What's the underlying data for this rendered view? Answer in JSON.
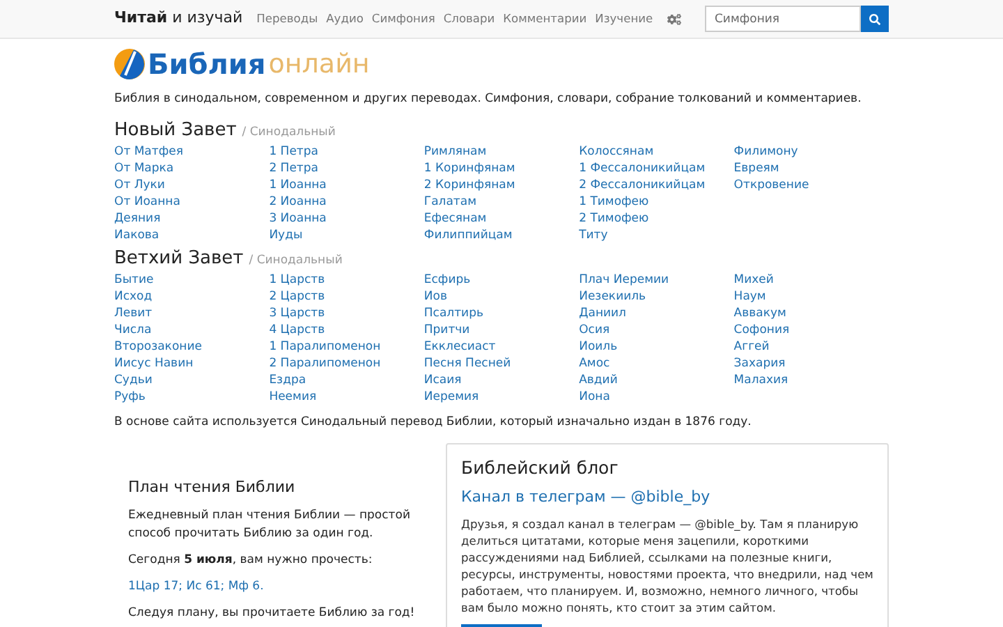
{
  "navbar": {
    "brand": "**Читай** и изучай",
    "links": [
      "Переводы",
      "Аудио",
      "Симфония",
      "Словари",
      "Комментарии",
      "Изучение"
    ],
    "search": {
      "placeholder": "Симфония"
    }
  },
  "logo": {
    "title": "Библия",
    "subtitle": "онлайн"
  },
  "tagline": "Библия в синодальном, современном и других переводах. Симфония, словари, собрание толкований и комментариев.",
  "sections": [
    {
      "title": "Новый Завет",
      "translation": "/ Синодальный",
      "columns": [
        [
          "От Матфея",
          "От Марка",
          "От Луки",
          "От Иоанна",
          "Деяния",
          "Иакова"
        ],
        [
          "1 Петра",
          "2 Петра",
          "1 Иоанна",
          "2 Иоанна",
          "3 Иоанна",
          "Иуды"
        ],
        [
          "Римлянам",
          "1 Коринфянам",
          "2 Коринфянам",
          "Галатам",
          "Ефесянам",
          "Филиппийцам"
        ],
        [
          "Колоссянам",
          "1 Фессалоникийцам",
          "2 Фессалоникийцам",
          "1 Тимофею",
          "2 Тимофею",
          "Титу"
        ],
        [
          "Филимону",
          "Евреям",
          "Откровение"
        ]
      ]
    },
    {
      "title": "Ветхий Завет",
      "translation": "/ Синодальный",
      "columns": [
        [
          "Бытие",
          "Исход",
          "Левит",
          "Числа",
          "Второзаконие",
          "Иисус Навин",
          "Судьи",
          "Руфь"
        ],
        [
          "1 Царств",
          "2 Царств",
          "3 Царств",
          "4 Царств",
          "1 Паралипоменон",
          "2 Паралипоменон",
          "Ездра",
          "Неемия"
        ],
        [
          "Есфирь",
          "Иов",
          "Псалтирь",
          "Притчи",
          "Екклесиаст",
          "Песня Песней",
          "Исаия",
          "Иеремия"
        ],
        [
          "Плач Иеремии",
          "Иезекииль",
          "Даниил",
          "Осия",
          "Иоиль",
          "Амос",
          "Авдий",
          "Иона"
        ],
        [
          "Михей",
          "Наум",
          "Аввакум",
          "Софония",
          "Аггей",
          "Захария",
          "Малахия"
        ]
      ]
    }
  ],
  "note": "В основе сайта используется Синодальный перевод Библии, который изначально издан в 1876 году.",
  "reading_plan": {
    "title": "План чтения Библии",
    "intro": "Ежедневный план чтения Библии — простой способ прочитать Библию за один год.",
    "today": "Сегодня **5 июля**, вам нужно прочесть:",
    "readings": [
      {
        "text": "1Цар 17",
        "after": "; "
      },
      {
        "text": "Ис 61",
        "after": "; "
      },
      {
        "text": "Мф 6",
        "after": "."
      }
    ],
    "outro": "Следуя плану, вы прочитаете Библию за год!"
  },
  "blog": {
    "title": "Библейский блог",
    "post_title": "Канал в телеграм — @bible_by",
    "post_text": "Друзья, я создал канал в телеграм — @bible_by. Там я планирую делиться цитатами, которые меня зацепили, короткими рассуждениями над Библией, ссылками на полезные книги, ресурсы, инструменты, новостями проекта, что внедрили, над чем работаем, что планируем. И, возможно, немного личного, чтобы вам было можно понять, кто стоит за этим сайтом."
  }
}
